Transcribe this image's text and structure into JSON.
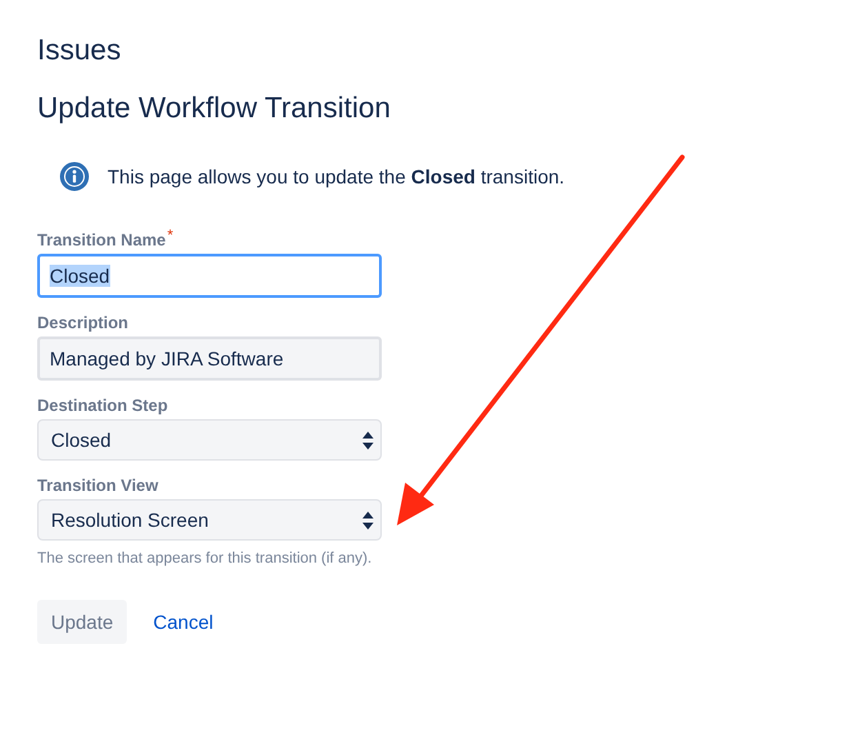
{
  "header": {
    "title": "Issues"
  },
  "page_title": "Update Workflow Transition",
  "info": {
    "message": "This page allows you to update the **Closed** transition."
  },
  "fields": [
    {
      "kind": "text",
      "label": "Transition Name",
      "required_mark": "*",
      "value": "Closed",
      "focused": true,
      "text_selected": true
    },
    {
      "kind": "text",
      "label": "Description",
      "value": "Managed by JIRA Software",
      "focused": false,
      "text_selected": false
    },
    {
      "kind": "select",
      "label": "Destination Step",
      "value": "Closed"
    },
    {
      "kind": "select",
      "label": "Transition View",
      "value": "Resolution Screen",
      "help": "The screen that appears for this transition (if any)."
    }
  ],
  "buttons": [
    {
      "kind": "button",
      "label": "Update",
      "disabled": true
    },
    {
      "kind": "link",
      "label": "Cancel",
      "disabled": false
    }
  ],
  "annotation": {
    "kind": "arrow",
    "color": "#ff2a12"
  }
}
